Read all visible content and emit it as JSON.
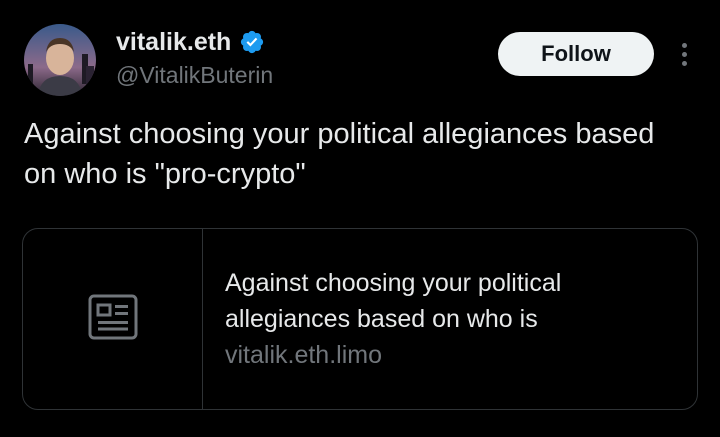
{
  "author": {
    "display_name": "vitalik.eth",
    "handle": "@VitalikButerin",
    "verified": true,
    "avatar_icon": "avatar-photo"
  },
  "actions": {
    "follow_label": "Follow",
    "more_icon": "more-options-icon"
  },
  "tweet": {
    "text": "Against choosing your political allegiances based on who is \"pro-crypto\""
  },
  "link_card": {
    "thumbnail_icon": "article-icon",
    "title": "Against choosing your political allegiances based on who is",
    "domain": "vitalik.eth.limo"
  },
  "colors": {
    "background": "#000000",
    "primary_text": "#e7e9ea",
    "secondary_text": "#71767b",
    "verified_badge": "#1d9bf0",
    "follow_button_bg": "#eff3f4",
    "border": "#2f3336"
  }
}
